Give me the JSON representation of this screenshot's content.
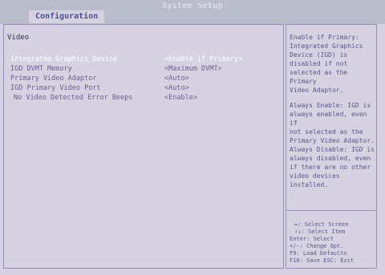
{
  "window": {
    "title": "System Setup",
    "active_tab": "Configuration"
  },
  "section": {
    "title": "Video"
  },
  "settings": [
    {
      "label": "Integrated Graphics Device",
      "value": "<Enable if Primary>",
      "selected": true
    },
    {
      "label": "IGD DVMT Memory",
      "value": "<Maximum DVMT>",
      "selected": false
    },
    {
      "label": "Primary Video Adaptor",
      "value": "<Auto>",
      "selected": false
    },
    {
      "label": "IGD Primary Video Port",
      "value": "<Auto>",
      "selected": false
    },
    {
      "label": "No Video Detected Error Beeps",
      "value": "<Enable>",
      "selected": false
    }
  ],
  "help": {
    "para1": "Enable if Primary:\nIntegrated Graphics\nDevice (IGD) is\ndisabled if not\nselected as the Primary\nVideo Adaptor.",
    "para2": "Always Enable: IGD is\nalways enabled, even if\nnot selected as the\nPrimary Video Adaptor.",
    "para3": "Always Disable: IGD is\nalways disabled, even\nif there are no other\nvideo devices installed."
  },
  "keys": {
    "select_screen": "↔: Select Screen",
    "select_item": "↑↓: Select Item",
    "enter": "Enter: Select",
    "change": "+/-: Change Opt.",
    "defaults": "F9: Load Defaults",
    "save_exit": "F10: Save  ESC: Exit"
  }
}
